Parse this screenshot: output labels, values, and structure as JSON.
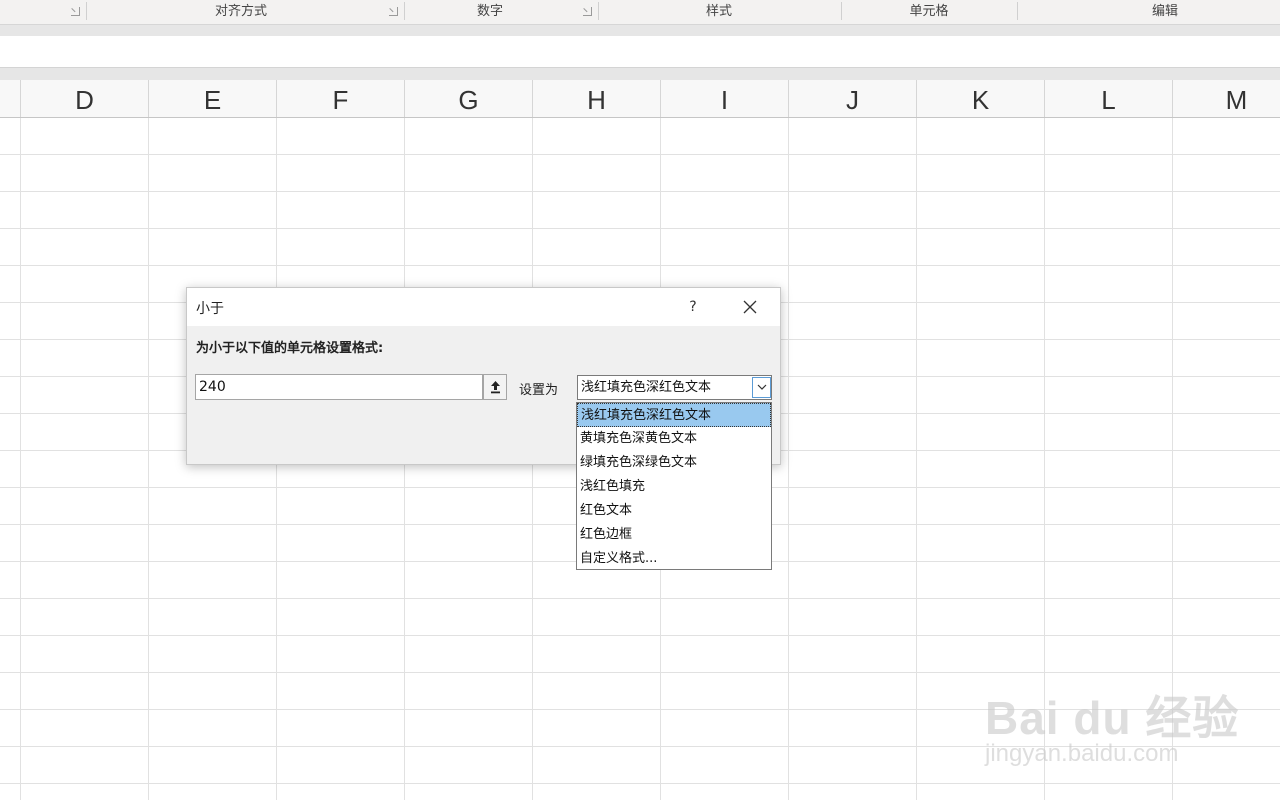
{
  "ribbon": {
    "groups": [
      "对齐方式",
      "数字",
      "样式",
      "单元格",
      "编辑"
    ]
  },
  "columns": [
    "D",
    "E",
    "F",
    "G",
    "H",
    "I",
    "J",
    "K",
    "L",
    "M"
  ],
  "dialog": {
    "title": "小于",
    "help_label": "?",
    "prompt": "为小于以下值的单元格设置格式:",
    "value": "240",
    "set_as_label": "设置为",
    "selected_format": "浅红填充色深红色文本",
    "options": [
      "浅红填充色深红色文本",
      "黄填充色深黄色文本",
      "绿填充色深绿色文本",
      "浅红色填充",
      "红色文本",
      "红色边框",
      "自定义格式..."
    ]
  },
  "watermark": {
    "main": "Bai du 经验",
    "sub": "jingyan.baidu.com"
  }
}
